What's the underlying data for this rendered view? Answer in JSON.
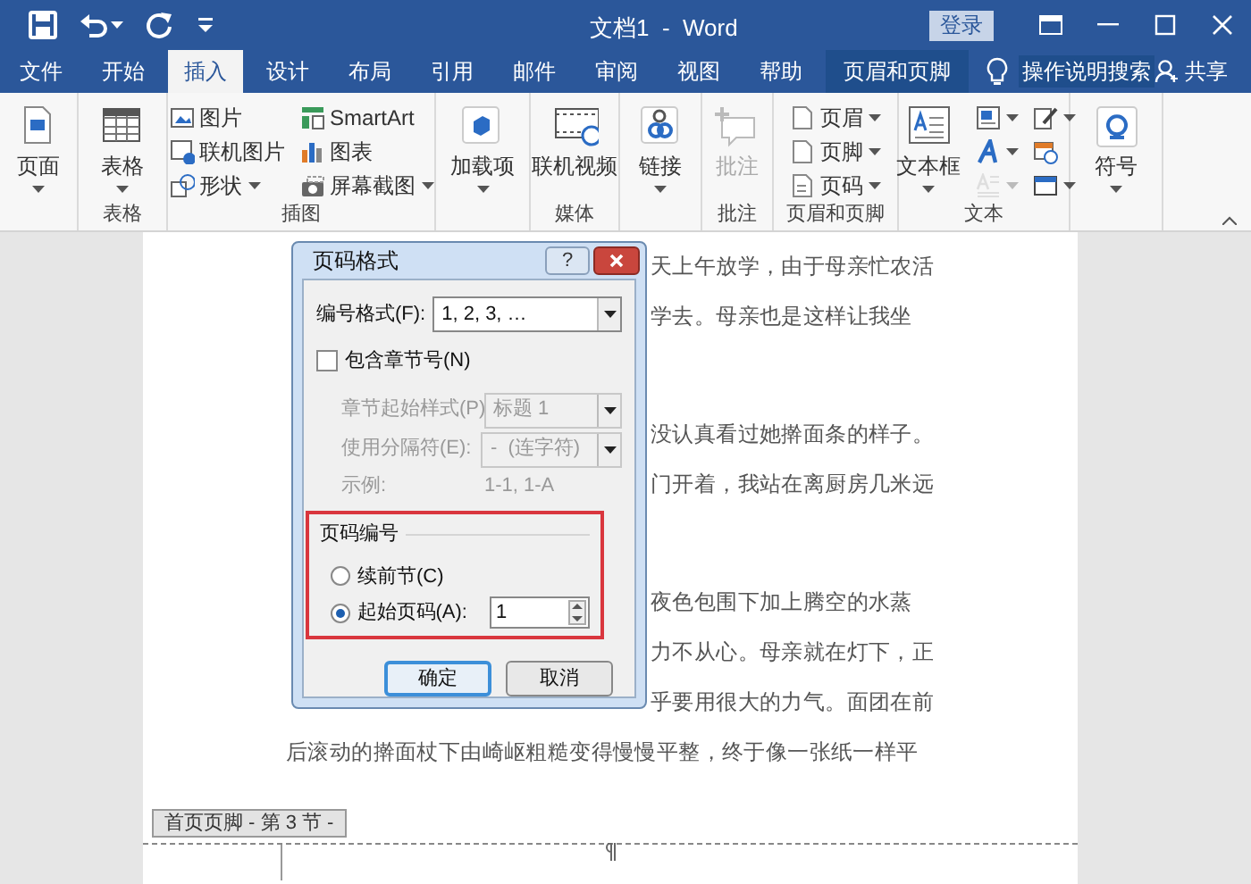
{
  "window": {
    "title": "文档1  -  Word"
  },
  "login_button": "登录",
  "tabs": [
    {
      "label": "文件",
      "selected": false,
      "kind": "normal"
    },
    {
      "label": "开始",
      "selected": false,
      "kind": "normal"
    },
    {
      "label": "插入",
      "selected": true,
      "kind": "normal"
    },
    {
      "label": "设计",
      "selected": false,
      "kind": "normal"
    },
    {
      "label": "布局",
      "selected": false,
      "kind": "normal"
    },
    {
      "label": "引用",
      "selected": false,
      "kind": "normal"
    },
    {
      "label": "邮件",
      "selected": false,
      "kind": "normal"
    },
    {
      "label": "审阅",
      "selected": false,
      "kind": "normal"
    },
    {
      "label": "视图",
      "selected": false,
      "kind": "normal"
    },
    {
      "label": "帮助",
      "selected": false,
      "kind": "normal"
    },
    {
      "label": "页眉和页脚",
      "selected": false,
      "kind": "contextual"
    }
  ],
  "tell_me": "操作说明搜索",
  "share": "共享",
  "ribbon_groups": [
    {
      "items": [
        {
          "kind": "large",
          "label": "页面",
          "dropdown": true,
          "disabled": false
        }
      ]
    },
    {
      "label": "表格",
      "items": [
        {
          "kind": "large",
          "label": "表格",
          "dropdown": true,
          "disabled": false
        }
      ]
    },
    {
      "label": "插图",
      "items": [
        {
          "kind": "small",
          "label": "图片",
          "dropdown": false,
          "disabled": false
        },
        {
          "kind": "small",
          "label": "联机图片",
          "dropdown": false,
          "disabled": false
        },
        {
          "kind": "small",
          "label": "形状",
          "dropdown": true,
          "disabled": false
        },
        {
          "kind": "small",
          "label": "SmartArt",
          "dropdown": false,
          "disabled": false
        },
        {
          "kind": "small",
          "label": "图表",
          "dropdown": false,
          "disabled": false
        },
        {
          "kind": "small",
          "label": "屏幕截图",
          "dropdown": true,
          "disabled": false
        }
      ]
    },
    {
      "items": [
        {
          "kind": "large",
          "label": "加载项",
          "dropdown": true,
          "disabled": false
        }
      ]
    },
    {
      "label": "媒体",
      "items": [
        {
          "kind": "large",
          "label": "联机视频",
          "dropdown": false,
          "disabled": false
        }
      ]
    },
    {
      "items": [
        {
          "kind": "large",
          "label": "链接",
          "dropdown": true,
          "disabled": false
        }
      ]
    },
    {
      "label": "批注",
      "items": [
        {
          "kind": "large",
          "label": "批注",
          "dropdown": false,
          "disabled": true
        }
      ]
    },
    {
      "label": "页眉和页脚",
      "items": [
        {
          "kind": "small",
          "label": "页眉",
          "dropdown": true,
          "disabled": false
        },
        {
          "kind": "small",
          "label": "页脚",
          "dropdown": true,
          "disabled": false
        },
        {
          "kind": "small",
          "label": "页码",
          "dropdown": true,
          "disabled": false
        }
      ]
    },
    {
      "label": "文本",
      "items": [
        {
          "kind": "large",
          "label": "文本框",
          "dropdown": true,
          "disabled": false
        },
        {
          "kind": "icon",
          "dropdown": true,
          "disabled": false
        },
        {
          "kind": "icon",
          "dropdown": true,
          "disabled": false
        },
        {
          "kind": "icon",
          "dropdown": true,
          "disabled": true
        },
        {
          "kind": "icon",
          "dropdown": true,
          "disabled": false
        },
        {
          "kind": "icon",
          "dropdown": false,
          "disabled": false
        },
        {
          "kind": "icon",
          "dropdown": true,
          "disabled": false
        }
      ]
    },
    {
      "items": [
        {
          "kind": "large",
          "label": "符号",
          "dropdown": true,
          "disabled": false
        }
      ]
    }
  ],
  "document": {
    "paragraphs": [
      {
        "lines": [
          {
            "text": "天上午放学，由于母亲忙农活",
            "kind": "covered"
          },
          {
            "text": "学去。母亲也是这样让我坐",
            "kind": "covered"
          }
        ]
      },
      {
        "lines": [
          {
            "text": "没认真看过她擀面条的样子。",
            "kind": "covered"
          },
          {
            "text": "门开着，我站在离厨房几米远",
            "kind": "covered"
          }
        ]
      },
      {
        "lines": [
          {
            "text": "夜色包围下加上腾空的水蒸",
            "kind": "covered"
          },
          {
            "text": "力不从心。母亲就在灯下，正",
            "kind": "covered"
          },
          {
            "text": "乎要用很大的力气。面团在前",
            "kind": "covered"
          },
          {
            "text": "后滚动的擀面杖下由崎岖粗糙变得慢慢平整，终于像一张纸一样平",
            "kind": "full"
          }
        ]
      }
    ],
    "footer_tab": "首页页脚 - 第 3 节 -"
  },
  "dialog": {
    "title": "页码格式",
    "help": "?",
    "number_format": {
      "label": "编号格式(F):",
      "value": "1, 2, 3, …"
    },
    "include_chapter": {
      "label": "包含章节号(N)",
      "checked": false
    },
    "chapter_style": {
      "label": "章节起始样式(P)",
      "value": "标题 1",
      "disabled": true
    },
    "separator": {
      "label": "使用分隔符(E):",
      "value": "-  (连字符)",
      "disabled": true
    },
    "example": {
      "label": "示例:",
      "value": "1-1, 1-A",
      "disabled": true
    },
    "numbering": {
      "title": "页码编号",
      "options": [
        {
          "label": "续前节(C)",
          "selected": false
        },
        {
          "label": "起始页码(A):",
          "selected": true
        }
      ],
      "start_value": "1"
    },
    "buttons": [
      {
        "label": "确定",
        "default": true
      },
      {
        "label": "取消",
        "default": false
      }
    ]
  }
}
